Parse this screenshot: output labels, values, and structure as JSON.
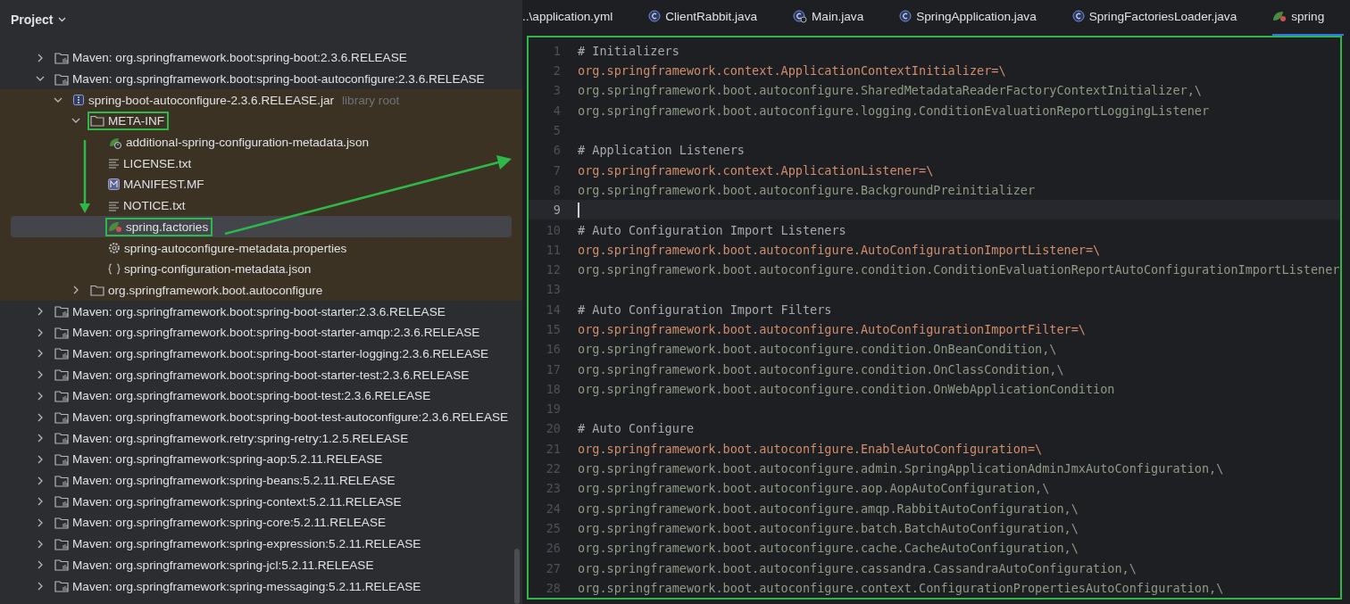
{
  "project_panel": {
    "title": "Project",
    "tree": [
      {
        "label": "Maven: org.springframework.boot:spring-boot:2.3.6.RELEASE",
        "kind": "library",
        "expanded": false,
        "selected": false
      },
      {
        "label": "Maven: org.springframework.boot:spring-boot-autoconfigure:2.3.6.RELEASE",
        "kind": "library",
        "expanded": true,
        "selected": false,
        "children": [
          {
            "label": "spring-boot-autoconfigure-2.3.6.RELEASE.jar",
            "note": "library root",
            "kind": "jar",
            "expanded": true,
            "selected": false,
            "highlighted": true,
            "children": [
              {
                "label": "META-INF",
                "kind": "folder",
                "expanded": true,
                "selected": false,
                "outlined": true,
                "children": [
                  {
                    "label": "additional-spring-configuration-metadata.json",
                    "kind": "spring-config",
                    "selected": false
                  },
                  {
                    "label": "LICENSE.txt",
                    "kind": "text",
                    "selected": false
                  },
                  {
                    "label": "MANIFEST.MF",
                    "kind": "manifest",
                    "selected": false
                  },
                  {
                    "label": "NOTICE.txt",
                    "kind": "text",
                    "selected": false
                  },
                  {
                    "label": "spring.factories",
                    "kind": "spring",
                    "selected": true,
                    "outlined": true
                  },
                  {
                    "label": "spring-autoconfigure-metadata.properties",
                    "kind": "settings",
                    "selected": false
                  },
                  {
                    "label": "spring-configuration-metadata.json",
                    "kind": "json",
                    "selected": false
                  }
                ]
              },
              {
                "label": "org.springframework.boot.autoconfigure",
                "kind": "folder",
                "expanded": false,
                "selected": false
              }
            ]
          }
        ]
      },
      {
        "label": "Maven: org.springframework.boot:spring-boot-starter:2.3.6.RELEASE",
        "kind": "library",
        "expanded": false,
        "selected": false
      },
      {
        "label": "Maven: org.springframework.boot:spring-boot-starter-amqp:2.3.6.RELEASE",
        "kind": "library",
        "expanded": false,
        "selected": false
      },
      {
        "label": "Maven: org.springframework.boot:spring-boot-starter-logging:2.3.6.RELEASE",
        "kind": "library",
        "expanded": false,
        "selected": false
      },
      {
        "label": "Maven: org.springframework.boot:spring-boot-starter-test:2.3.6.RELEASE",
        "kind": "library",
        "expanded": false,
        "selected": false
      },
      {
        "label": "Maven: org.springframework.boot:spring-boot-test:2.3.6.RELEASE",
        "kind": "library",
        "expanded": false,
        "selected": false
      },
      {
        "label": "Maven: org.springframework.boot:spring-boot-test-autoconfigure:2.3.6.RELEASE",
        "kind": "library",
        "expanded": false,
        "selected": false
      },
      {
        "label": "Maven: org.springframework.retry:spring-retry:1.2.5.RELEASE",
        "kind": "library",
        "expanded": false,
        "selected": false
      },
      {
        "label": "Maven: org.springframework:spring-aop:5.2.11.RELEASE",
        "kind": "library",
        "expanded": false,
        "selected": false
      },
      {
        "label": "Maven: org.springframework:spring-beans:5.2.11.RELEASE",
        "kind": "library",
        "expanded": false,
        "selected": false
      },
      {
        "label": "Maven: org.springframework:spring-context:5.2.11.RELEASE",
        "kind": "library",
        "expanded": false,
        "selected": false
      },
      {
        "label": "Maven: org.springframework:spring-core:5.2.11.RELEASE",
        "kind": "library",
        "expanded": false,
        "selected": false
      },
      {
        "label": "Maven: org.springframework:spring-expression:5.2.11.RELEASE",
        "kind": "library",
        "expanded": false,
        "selected": false
      },
      {
        "label": "Maven: org.springframework:spring-jcl:5.2.11.RELEASE",
        "kind": "library",
        "expanded": false,
        "selected": false
      },
      {
        "label": "Maven: org.springframework:spring-messaging:5.2.11.RELEASE",
        "kind": "library",
        "expanded": false,
        "selected": false
      }
    ]
  },
  "editor_tabs": [
    {
      "label": "..\\application.yml",
      "kind": "plain",
      "selected": false
    },
    {
      "label": "ClientRabbit.java",
      "kind": "class",
      "selected": false
    },
    {
      "label": "Main.java",
      "kind": "main-class",
      "selected": false
    },
    {
      "label": "SpringApplication.java",
      "kind": "class",
      "selected": false
    },
    {
      "label": "SpringFactoriesLoader.java",
      "kind": "class",
      "selected": false
    },
    {
      "label": "spring",
      "kind": "spring",
      "selected": true
    }
  ],
  "editor": {
    "outlined": true,
    "lines": [
      {
        "number": "1",
        "kind": "comment",
        "text": "# Initializers",
        "current": false
      },
      {
        "number": "2",
        "kind": "key",
        "text": "org.springframework.context.ApplicationContextInitializer=\\",
        "current": false
      },
      {
        "number": "3",
        "kind": "value",
        "text": "org.springframework.boot.autoconfigure.SharedMetadataReaderFactoryContextInitializer,\\",
        "current": false
      },
      {
        "number": "4",
        "kind": "value",
        "text": "org.springframework.boot.autoconfigure.logging.ConditionEvaluationReportLoggingListener",
        "current": false
      },
      {
        "number": "5",
        "kind": "blank",
        "current": false
      },
      {
        "number": "6",
        "kind": "comment",
        "text": "# Application Listeners",
        "current": false
      },
      {
        "number": "7",
        "kind": "key",
        "text": "org.springframework.context.ApplicationListener=\\",
        "current": false
      },
      {
        "number": "8",
        "kind": "value",
        "text": "org.springframework.boot.autoconfigure.BackgroundPreinitializer",
        "current": false
      },
      {
        "number": "9",
        "kind": "blank",
        "current": true
      },
      {
        "number": "10",
        "kind": "comment",
        "text": "# Auto Configuration Import Listeners",
        "current": false
      },
      {
        "number": "11",
        "kind": "key",
        "text": "org.springframework.boot.autoconfigure.AutoConfigurationImportListener=\\",
        "current": false
      },
      {
        "number": "12",
        "kind": "value",
        "text": "org.springframework.boot.autoconfigure.condition.ConditionEvaluationReportAutoConfigurationImportListener",
        "current": false
      },
      {
        "number": "13",
        "kind": "blank",
        "current": false
      },
      {
        "number": "14",
        "kind": "comment",
        "text": "# Auto Configuration Import Filters",
        "current": false
      },
      {
        "number": "15",
        "kind": "key",
        "text": "org.springframework.boot.autoconfigure.AutoConfigurationImportFilter=\\",
        "current": false
      },
      {
        "number": "16",
        "kind": "value",
        "text": "org.springframework.boot.autoconfigure.condition.OnBeanCondition,\\",
        "current": false
      },
      {
        "number": "17",
        "kind": "value",
        "text": "org.springframework.boot.autoconfigure.condition.OnClassCondition,\\",
        "current": false
      },
      {
        "number": "18",
        "kind": "value",
        "text": "org.springframework.boot.autoconfigure.condition.OnWebApplicationCondition",
        "current": false
      },
      {
        "number": "19",
        "kind": "blank",
        "current": false
      },
      {
        "number": "20",
        "kind": "comment",
        "text": "# Auto Configure",
        "current": false
      },
      {
        "number": "21",
        "kind": "key",
        "text": "org.springframework.boot.autoconfigure.EnableAutoConfiguration=\\",
        "current": false
      },
      {
        "number": "22",
        "kind": "value",
        "text": "org.springframework.boot.autoconfigure.admin.SpringApplicationAdminJmxAutoConfiguration,\\",
        "current": false
      },
      {
        "number": "23",
        "kind": "value",
        "text": "org.springframework.boot.autoconfigure.aop.AopAutoConfiguration,\\",
        "current": false
      },
      {
        "number": "24",
        "kind": "value",
        "text": "org.springframework.boot.autoconfigure.amqp.RabbitAutoConfiguration,\\",
        "current": false
      },
      {
        "number": "25",
        "kind": "value",
        "text": "org.springframework.boot.autoconfigure.batch.BatchAutoConfiguration,\\",
        "current": false
      },
      {
        "number": "26",
        "kind": "value",
        "text": "org.springframework.boot.autoconfigure.cache.CacheAutoConfiguration,\\",
        "current": false
      },
      {
        "number": "27",
        "kind": "value",
        "text": "org.springframework.boot.autoconfigure.cassandra.CassandraAutoConfiguration,\\",
        "current": false
      },
      {
        "number": "28",
        "kind": "value",
        "text": "org.springframework.boot.autoconfigure.context.ConfigurationPropertiesAutoConfiguration,\\",
        "current": false
      }
    ]
  }
}
